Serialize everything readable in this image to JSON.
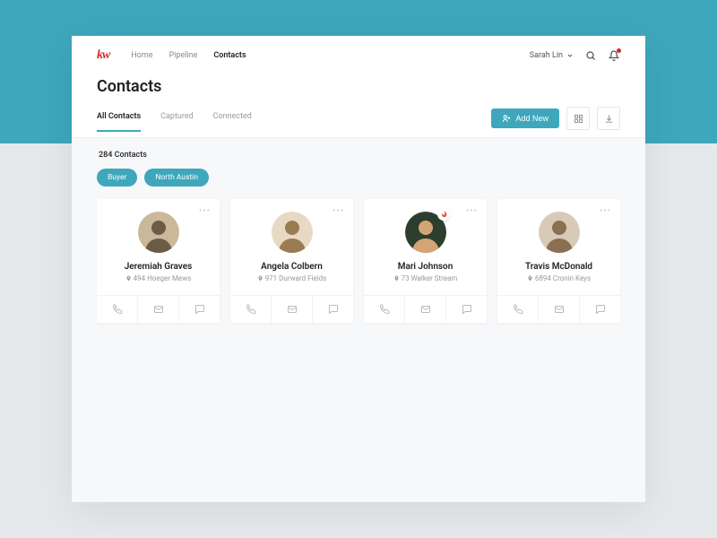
{
  "brand": "kw",
  "nav": {
    "items": [
      {
        "label": "Home",
        "active": false
      },
      {
        "label": "Pipeline",
        "active": false
      },
      {
        "label": "Contacts",
        "active": true
      }
    ]
  },
  "user": {
    "name": "Sarah Lin"
  },
  "page": {
    "title": "Contacts"
  },
  "tabs": [
    {
      "label": "All Contacts",
      "active": true
    },
    {
      "label": "Captured",
      "active": false
    },
    {
      "label": "Connected",
      "active": false
    }
  ],
  "actions": {
    "add_label": "Add New"
  },
  "summary": {
    "count_text": "284 Contacts"
  },
  "filters": [
    {
      "label": "Buyer"
    },
    {
      "label": "North Austin"
    }
  ],
  "contacts": [
    {
      "name": "Jeremiah Graves",
      "address": "494 Hoeger Mews",
      "hot": false,
      "avatar_bg": "#cbb89a",
      "avatar_fg": "#6b5b47"
    },
    {
      "name": "Angela Colbern",
      "address": "971 Durward Fields",
      "hot": false,
      "avatar_bg": "#e8d9c4",
      "avatar_fg": "#9a7b52"
    },
    {
      "name": "Mari Johnson",
      "address": "73 Walker Stream",
      "hot": true,
      "avatar_bg": "#2d3e2e",
      "avatar_fg": "#d4a574"
    },
    {
      "name": "Travis McDonald",
      "address": "6894 Cronin Keys",
      "hot": false,
      "avatar_bg": "#d8c9b8",
      "avatar_fg": "#8a6f52"
    }
  ]
}
